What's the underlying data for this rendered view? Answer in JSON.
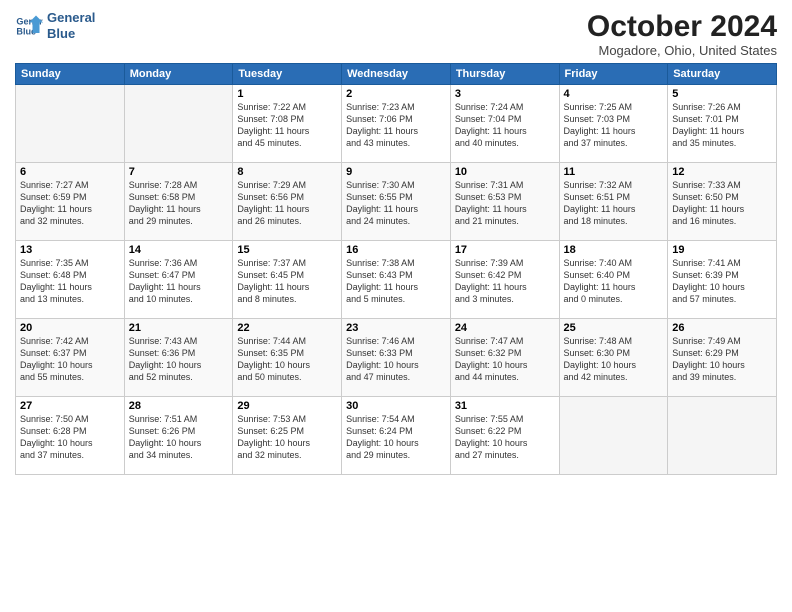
{
  "header": {
    "logo_line1": "General",
    "logo_line2": "Blue",
    "month": "October 2024",
    "location": "Mogadore, Ohio, United States"
  },
  "days_of_week": [
    "Sunday",
    "Monday",
    "Tuesday",
    "Wednesday",
    "Thursday",
    "Friday",
    "Saturday"
  ],
  "weeks": [
    [
      {
        "day": "",
        "info": ""
      },
      {
        "day": "",
        "info": ""
      },
      {
        "day": "1",
        "info": "Sunrise: 7:22 AM\nSunset: 7:08 PM\nDaylight: 11 hours\nand 45 minutes."
      },
      {
        "day": "2",
        "info": "Sunrise: 7:23 AM\nSunset: 7:06 PM\nDaylight: 11 hours\nand 43 minutes."
      },
      {
        "day": "3",
        "info": "Sunrise: 7:24 AM\nSunset: 7:04 PM\nDaylight: 11 hours\nand 40 minutes."
      },
      {
        "day": "4",
        "info": "Sunrise: 7:25 AM\nSunset: 7:03 PM\nDaylight: 11 hours\nand 37 minutes."
      },
      {
        "day": "5",
        "info": "Sunrise: 7:26 AM\nSunset: 7:01 PM\nDaylight: 11 hours\nand 35 minutes."
      }
    ],
    [
      {
        "day": "6",
        "info": "Sunrise: 7:27 AM\nSunset: 6:59 PM\nDaylight: 11 hours\nand 32 minutes."
      },
      {
        "day": "7",
        "info": "Sunrise: 7:28 AM\nSunset: 6:58 PM\nDaylight: 11 hours\nand 29 minutes."
      },
      {
        "day": "8",
        "info": "Sunrise: 7:29 AM\nSunset: 6:56 PM\nDaylight: 11 hours\nand 26 minutes."
      },
      {
        "day": "9",
        "info": "Sunrise: 7:30 AM\nSunset: 6:55 PM\nDaylight: 11 hours\nand 24 minutes."
      },
      {
        "day": "10",
        "info": "Sunrise: 7:31 AM\nSunset: 6:53 PM\nDaylight: 11 hours\nand 21 minutes."
      },
      {
        "day": "11",
        "info": "Sunrise: 7:32 AM\nSunset: 6:51 PM\nDaylight: 11 hours\nand 18 minutes."
      },
      {
        "day": "12",
        "info": "Sunrise: 7:33 AM\nSunset: 6:50 PM\nDaylight: 11 hours\nand 16 minutes."
      }
    ],
    [
      {
        "day": "13",
        "info": "Sunrise: 7:35 AM\nSunset: 6:48 PM\nDaylight: 11 hours\nand 13 minutes."
      },
      {
        "day": "14",
        "info": "Sunrise: 7:36 AM\nSunset: 6:47 PM\nDaylight: 11 hours\nand 10 minutes."
      },
      {
        "day": "15",
        "info": "Sunrise: 7:37 AM\nSunset: 6:45 PM\nDaylight: 11 hours\nand 8 minutes."
      },
      {
        "day": "16",
        "info": "Sunrise: 7:38 AM\nSunset: 6:43 PM\nDaylight: 11 hours\nand 5 minutes."
      },
      {
        "day": "17",
        "info": "Sunrise: 7:39 AM\nSunset: 6:42 PM\nDaylight: 11 hours\nand 3 minutes."
      },
      {
        "day": "18",
        "info": "Sunrise: 7:40 AM\nSunset: 6:40 PM\nDaylight: 11 hours\nand 0 minutes."
      },
      {
        "day": "19",
        "info": "Sunrise: 7:41 AM\nSunset: 6:39 PM\nDaylight: 10 hours\nand 57 minutes."
      }
    ],
    [
      {
        "day": "20",
        "info": "Sunrise: 7:42 AM\nSunset: 6:37 PM\nDaylight: 10 hours\nand 55 minutes."
      },
      {
        "day": "21",
        "info": "Sunrise: 7:43 AM\nSunset: 6:36 PM\nDaylight: 10 hours\nand 52 minutes."
      },
      {
        "day": "22",
        "info": "Sunrise: 7:44 AM\nSunset: 6:35 PM\nDaylight: 10 hours\nand 50 minutes."
      },
      {
        "day": "23",
        "info": "Sunrise: 7:46 AM\nSunset: 6:33 PM\nDaylight: 10 hours\nand 47 minutes."
      },
      {
        "day": "24",
        "info": "Sunrise: 7:47 AM\nSunset: 6:32 PM\nDaylight: 10 hours\nand 44 minutes."
      },
      {
        "day": "25",
        "info": "Sunrise: 7:48 AM\nSunset: 6:30 PM\nDaylight: 10 hours\nand 42 minutes."
      },
      {
        "day": "26",
        "info": "Sunrise: 7:49 AM\nSunset: 6:29 PM\nDaylight: 10 hours\nand 39 minutes."
      }
    ],
    [
      {
        "day": "27",
        "info": "Sunrise: 7:50 AM\nSunset: 6:28 PM\nDaylight: 10 hours\nand 37 minutes."
      },
      {
        "day": "28",
        "info": "Sunrise: 7:51 AM\nSunset: 6:26 PM\nDaylight: 10 hours\nand 34 minutes."
      },
      {
        "day": "29",
        "info": "Sunrise: 7:53 AM\nSunset: 6:25 PM\nDaylight: 10 hours\nand 32 minutes."
      },
      {
        "day": "30",
        "info": "Sunrise: 7:54 AM\nSunset: 6:24 PM\nDaylight: 10 hours\nand 29 minutes."
      },
      {
        "day": "31",
        "info": "Sunrise: 7:55 AM\nSunset: 6:22 PM\nDaylight: 10 hours\nand 27 minutes."
      },
      {
        "day": "",
        "info": ""
      },
      {
        "day": "",
        "info": ""
      }
    ]
  ]
}
